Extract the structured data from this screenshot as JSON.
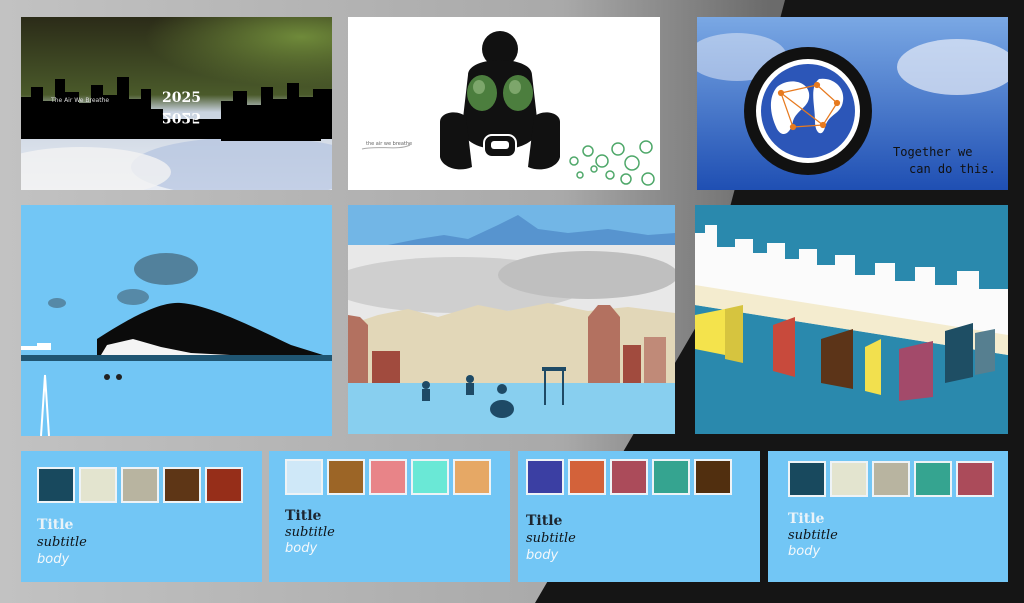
{
  "slides": {
    "s1": {
      "small_title": "The Air We Breathe",
      "year": "2025",
      "year_flipped": "2025"
    },
    "s2": {
      "small_title": "the air we breathe"
    },
    "s3": {
      "line1": "Together we",
      "line2": "can do this."
    }
  },
  "palettes": [
    {
      "title": "Title",
      "subtitle": "subtitle",
      "body": "body",
      "colors": [
        "#18495e",
        "#e3e4cf",
        "#b8b4a0",
        "#5e3616",
        "#962e19"
      ]
    },
    {
      "title": "Title",
      "subtitle": "subtitle",
      "body": "body",
      "colors": [
        "#cfe8f8",
        "#9c6526",
        "#e88488",
        "#6ae8d6",
        "#e6a865"
      ]
    },
    {
      "title": "Title",
      "subtitle": "subtitle",
      "body": "body",
      "colors": [
        "#3b3fa3",
        "#d3623a",
        "#ab4b5a",
        "#35a490",
        "#512f0f"
      ]
    },
    {
      "title": "Title",
      "subtitle": "subtitle",
      "body": "body",
      "colors": [
        "#18495e",
        "#e3e4cf",
        "#b8b4a0",
        "#35a490",
        "#ab4b5a"
      ]
    }
  ]
}
